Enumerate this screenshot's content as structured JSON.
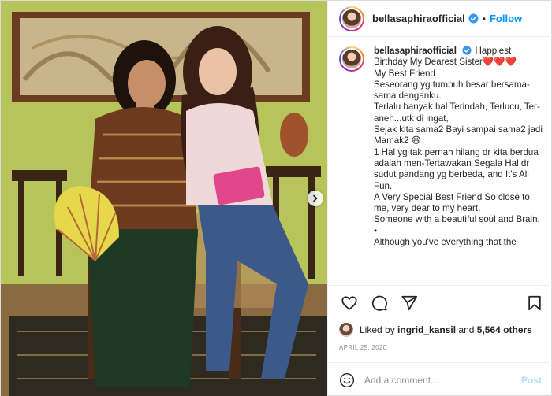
{
  "post": {
    "username": "bellasaphiraofficial",
    "follow_label": "Follow",
    "separator": "•",
    "more_label": "•••"
  },
  "caption": {
    "username": "bellasaphiraofficial",
    "lines": [
      "Happiest Birthday My Dearest Sister❤️❤️❤️",
      "My Best Friend",
      "Seseorang yg tumbuh besar bersama-sama denganku.",
      "Terlalu banyak hal Terindah, Terlucu, Ter-aneh...utk di ingat,",
      "Sejak kita sama2 Bayi sampai sama2 jadi Mamak2 😆",
      "1 Hal yg tak pernah hilang dr kita berdua adalah men-Tertawakan Segala Hal dr sudut pandang yg berbeda, and It's All Fun.",
      "A Very Special Best Friend So close to me, very dear to my heart,",
      "Someone with a beautiful soul and Brain.",
      "•",
      "Although you've everything that the"
    ]
  },
  "likes": {
    "prefix": "Liked by",
    "user": "ingrid_kansil",
    "middle": "and",
    "count": "5,564 others"
  },
  "date": "APRIL 25, 2020",
  "comment_box": {
    "placeholder": "Add a comment...",
    "post_label": "Post"
  },
  "icons": {
    "verified": "verified-badge-icon",
    "like": "heart-icon",
    "comment": "comment-icon",
    "share": "paper-plane-icon",
    "save": "bookmark-icon",
    "emoji": "emoji-icon",
    "next": "chevron-right-icon"
  },
  "colors": {
    "follow": "#0095f6",
    "verified": "#3897f0",
    "post_disabled": "#b2dffc"
  }
}
